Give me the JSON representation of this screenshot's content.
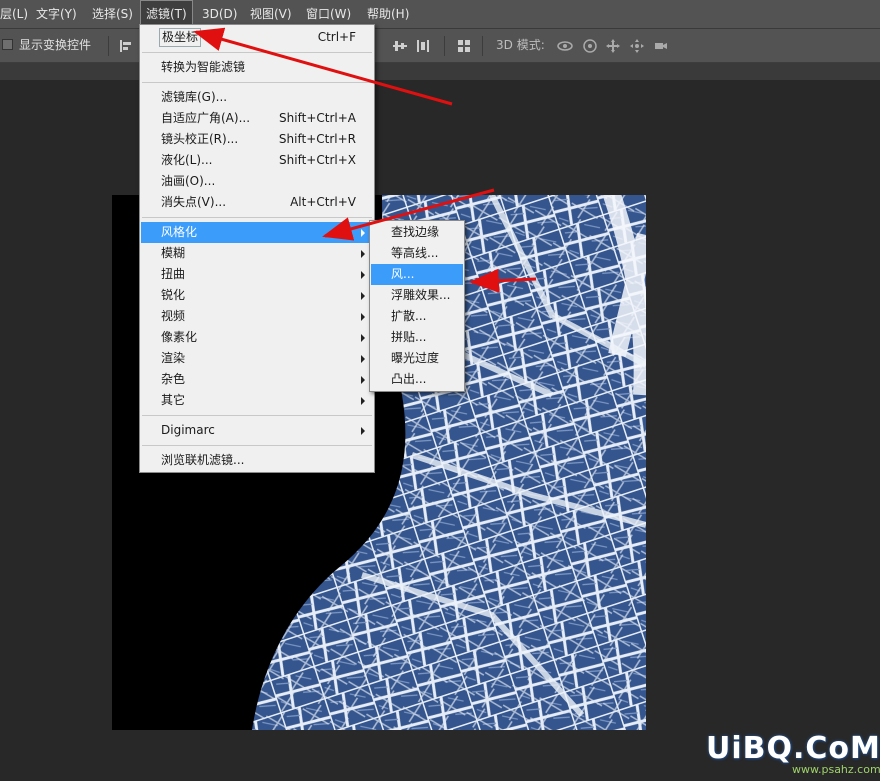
{
  "menubar": {
    "items": [
      {
        "label": "层(L)"
      },
      {
        "label": "文字(Y)"
      },
      {
        "label": "选择(S)"
      },
      {
        "label": "滤镜(T)"
      },
      {
        "label": "3D(D)"
      },
      {
        "label": "视图(V)"
      },
      {
        "label": "窗口(W)"
      },
      {
        "label": "帮助(H)"
      }
    ]
  },
  "optbar": {
    "show_transform_controls": "显示变换控件",
    "mode_3d_label": "3D 模式:"
  },
  "filter_menu": {
    "last_filter": {
      "label": "极坐标",
      "shortcut": "Ctrl+F"
    },
    "convert_smart": {
      "label": "转换为智能滤镜"
    },
    "gallery": {
      "label": "滤镜库(G)..."
    },
    "adaptive_wide": {
      "label": "自适应广角(A)...",
      "shortcut": "Shift+Ctrl+A"
    },
    "lens_correction": {
      "label": "镜头校正(R)...",
      "shortcut": "Shift+Ctrl+R"
    },
    "liquify": {
      "label": "液化(L)...",
      "shortcut": "Shift+Ctrl+X"
    },
    "oil_paint": {
      "label": "油画(O)..."
    },
    "vanishing_point": {
      "label": "消失点(V)...",
      "shortcut": "Alt+Ctrl+V"
    },
    "stylize": {
      "label": "风格化"
    },
    "blur": {
      "label": "模糊"
    },
    "distort": {
      "label": "扭曲"
    },
    "sharpen": {
      "label": "锐化"
    },
    "video": {
      "label": "视频"
    },
    "pixelate": {
      "label": "像素化"
    },
    "render": {
      "label": "渲染"
    },
    "noise": {
      "label": "杂色"
    },
    "other": {
      "label": "其它"
    },
    "digimarc": {
      "label": "Digimarc"
    },
    "browse_online": {
      "label": "浏览联机滤镜..."
    }
  },
  "stylize_menu": {
    "items": [
      {
        "label": "查找边缘"
      },
      {
        "label": "等高线..."
      },
      {
        "label": "风..."
      },
      {
        "label": "浮雕效果..."
      },
      {
        "label": "扩散..."
      },
      {
        "label": "拼贴..."
      },
      {
        "label": "曝光过度"
      },
      {
        "label": "凸出..."
      }
    ],
    "highlighted": "风..."
  },
  "watermark": {
    "text": "UiBQ.CoM",
    "sub": "www.psahz.com"
  },
  "colors": {
    "menu_highlight": "#3c9cfa",
    "annotation_arrow": "#e01010",
    "canvas_blue": "#2f4f86"
  }
}
